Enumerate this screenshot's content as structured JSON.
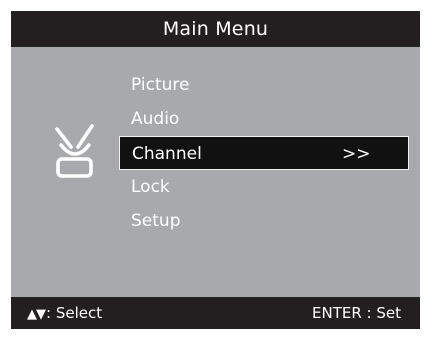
{
  "window": {
    "title": "Main Menu"
  },
  "menu": {
    "items": [
      {
        "label": "Picture",
        "selected": false,
        "indicator": ""
      },
      {
        "label": "Audio",
        "selected": false,
        "indicator": ""
      },
      {
        "label": "Channel",
        "selected": true,
        "indicator": ">>"
      },
      {
        "label": "Lock",
        "selected": false,
        "indicator": ""
      },
      {
        "label": "Setup",
        "selected": false,
        "indicator": ""
      }
    ]
  },
  "footer": {
    "select_glyphs": "▲▼",
    "select_label": ": Select",
    "set_hint": "ENTER : Set"
  },
  "icons": {
    "section_icon": "channel-antenna-icon"
  },
  "colors": {
    "panel_background": "#a7a9ac",
    "bar_background": "#231f20",
    "highlight_background": "#111111",
    "text": "#ffffff"
  }
}
